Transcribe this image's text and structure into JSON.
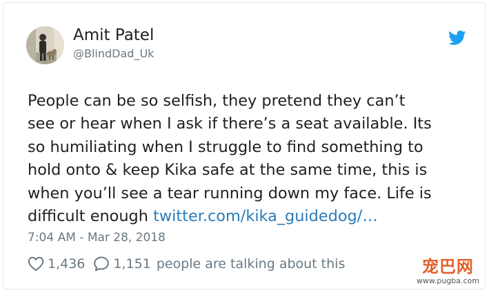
{
  "user": {
    "display_name": "Amit Patel",
    "handle": "@BlindDad_Uk"
  },
  "tweet": {
    "lines": [
      "People can be so selfish, they pretend they can’t",
      "see or hear when I ask if there’s a seat available. Its",
      "so humiliating when I struggle to find something to",
      "hold onto & keep Kika safe at the same time, this is",
      "when you’ll see a tear running down my face. Life is"
    ],
    "last_line_text": "difficult enough ",
    "link_text": "twitter.com/kika_guidedog/…",
    "timestamp": "7:04 AM - Mar 28, 2018"
  },
  "actions": {
    "likes": "1,436",
    "replies": "1,151",
    "talking_text": "people are talking about this"
  },
  "watermark": {
    "name": "宠巴网",
    "url": "www.pugba.com"
  },
  "colors": {
    "text": "#1c2022",
    "secondary": "#697882",
    "link": "#2b7bb9",
    "twitter_blue": "#1da1f2",
    "border": "#e1e8ed",
    "watermark": "#e0612a"
  },
  "icons": {
    "avatar": "profile-photo",
    "brand": "twitter-bird-icon",
    "like": "heart-icon",
    "reply": "speech-bubble-icon"
  }
}
